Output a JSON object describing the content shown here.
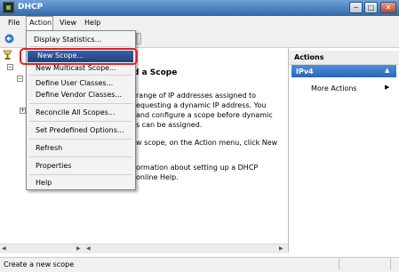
{
  "window": {
    "title": "DHCP",
    "minimize": "─",
    "maximize": "□",
    "close": "✕"
  },
  "menubar": {
    "file": "File",
    "action": "Action",
    "view": "View",
    "help": "Help"
  },
  "action_menu": {
    "display_statistics": "Display Statistics...",
    "new_scope": "New Scope...",
    "new_multicast_scope": "New Multicast Scope...",
    "define_user_classes": "Define User Classes...",
    "define_vendor_classes": "Define Vendor Classes...",
    "reconcile_all_scopes": "Reconcile All Scopes...",
    "set_predefined_options": "Set Predefined Options...",
    "refresh": "Refresh",
    "properties": "Properties",
    "help": "Help"
  },
  "center": {
    "heading": "d a Scope",
    "lines": [
      "range of IP addresses assigned to",
      "equesting a dynamic IP address. You",
      "and configure a scope before dynamic",
      "s can be assigned.",
      "",
      "w scope, on the Action menu, click New",
      "",
      "",
      "ormation about setting up a DHCP",
      "online Help."
    ]
  },
  "actions": {
    "header": "Actions",
    "section": "IPv4",
    "more_actions": "More Actions"
  },
  "status": {
    "text": "Create a new scope"
  },
  "colors": {
    "highlight_border": "#e02020",
    "selected_item": "#203f7d",
    "ipv4_bar": "#2a66b8"
  }
}
